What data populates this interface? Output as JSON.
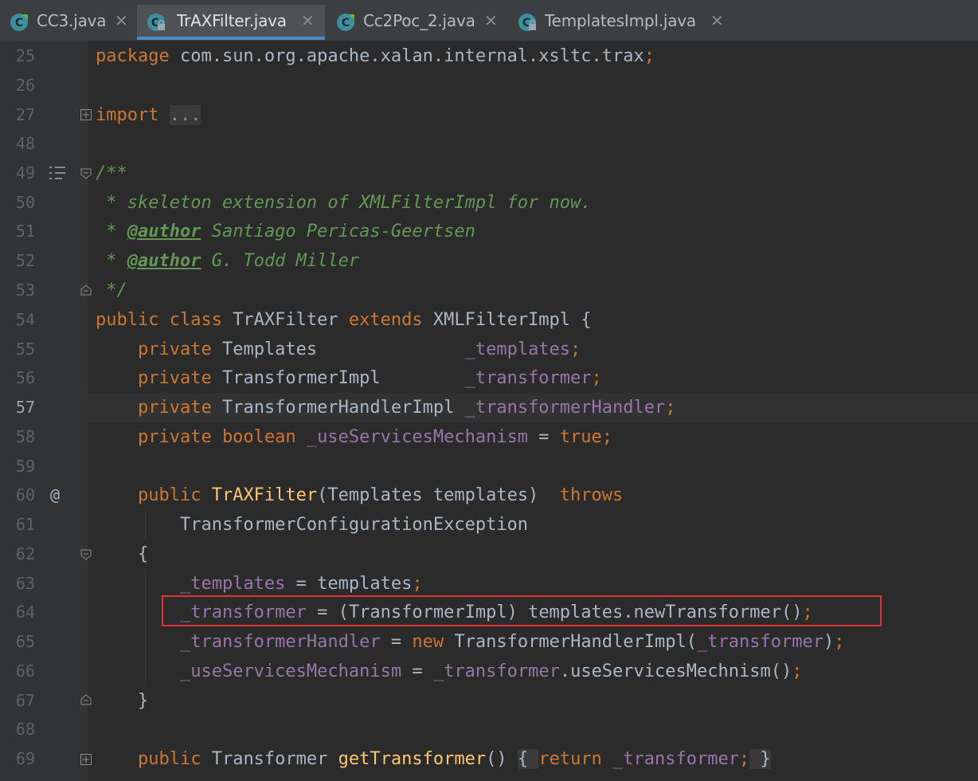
{
  "tabs": [
    {
      "label": "CC3.java",
      "close": "✕"
    },
    {
      "label": "TrAXFilter.java",
      "close": "✕"
    },
    {
      "label": "Cc2Poc_2.java",
      "close": "✕"
    },
    {
      "label": "TemplatesImpl.java",
      "close": "✕"
    }
  ],
  "line_numbers": [
    "25",
    "26",
    "27",
    "48",
    "49",
    "50",
    "51",
    "52",
    "53",
    "54",
    "55",
    "56",
    "57",
    "58",
    "59",
    "60",
    "61",
    "62",
    "63",
    "64",
    "65",
    "66",
    "67",
    "68",
    "69"
  ],
  "gutter": {
    "override_marker": "@"
  },
  "code": {
    "l25": {
      "kw": "package",
      "rest": " com.sun.org.apache.xalan.internal.xsltc.trax",
      "semi": ";"
    },
    "l27": {
      "kw": "import",
      "sp": " ",
      "folded": "..."
    },
    "l49": {
      "c": "/**"
    },
    "l50": {
      "c": " * skeleton extension of XMLFilterImpl for now."
    },
    "l51": {
      "c1": " * ",
      "tag": "@author",
      "c2": " Santiago Pericas-Geertsen"
    },
    "l52": {
      "c1": " * ",
      "tag": "@author",
      "c2": " G. Todd Miller"
    },
    "l53": {
      "c": " */"
    },
    "l54": {
      "k1": "public class ",
      "name": "TrAXFilter ",
      "k2": "extends ",
      "rest": "XMLFilterImpl {"
    },
    "l55": {
      "k": "    private ",
      "t": "Templates              ",
      "f": "_templates",
      "s": ";"
    },
    "l56": {
      "k": "    private ",
      "t": "TransformerImpl        ",
      "f": "_transformer",
      "s": ";"
    },
    "l57": {
      "k": "    private ",
      "t": "TransformerHandlerImpl ",
      "f": "_transformerHandler",
      "s": ";"
    },
    "l58": {
      "k": "    private boolean ",
      "f": "_useServicesMechanism",
      "eq": " = ",
      "v": "true",
      "s": ";"
    },
    "l60": {
      "k": "    public ",
      "fn": "TrAXFilter",
      "p": "(Templates templates)  ",
      "th": "throws"
    },
    "l61": {
      "t": "        TransformerConfigurationException"
    },
    "l62": {
      "t": "    {"
    },
    "l63": {
      "ind": "        ",
      "f": "_templates",
      "r": " = templates",
      "s": ";"
    },
    "l64": {
      "ind": "        ",
      "f": "_transformer",
      "r": " = (TransformerImpl) templates.newTransformer()",
      "s": ";"
    },
    "l65": {
      "ind": "        ",
      "f": "_transformerHandler",
      "eq": " = ",
      "n": "new ",
      "r": "TransformerHandlerImpl(",
      "f2": "_transformer",
      "r2": ")",
      "s": ";"
    },
    "l66": {
      "ind": "        ",
      "f": "_useServicesMechanism",
      "eq": " = ",
      "f2": "_transformer",
      "r": ".useServicesMechnism()",
      "s": ";"
    },
    "l67": {
      "t": "    }"
    },
    "l69": {
      "k": "    public ",
      "t": "Transformer ",
      "fn": "getTransformer",
      "p": "() ",
      "b1": "{ ",
      "ret": "return ",
      "f": "_transformer",
      "s": ";",
      "b2": " }"
    }
  }
}
